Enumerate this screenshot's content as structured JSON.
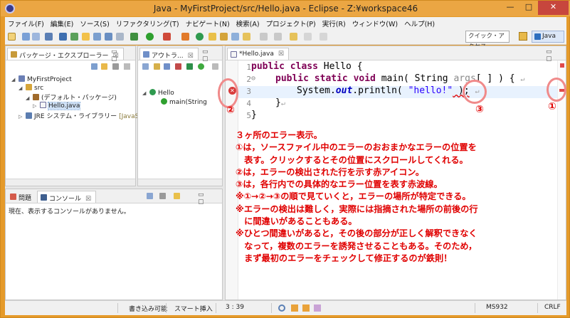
{
  "window": {
    "title": "Java - MyFirstProject/src/Hello.java - Eclipse - Z:¥workspace46",
    "minimize_glyph": "—",
    "maximize_glyph": "□",
    "close_glyph": "✕"
  },
  "menu": [
    "ファイル(F)",
    "編集(E)",
    "ソース(S)",
    "リファクタリング(T)",
    "ナビゲート(N)",
    "検索(A)",
    "プロジェクト(P)",
    "実行(R)",
    "ウィンドウ(W)",
    "ヘルプ(H)"
  ],
  "toolbar": {
    "quick_access": "クイック・アクセス",
    "perspective": "Java"
  },
  "package_explorer": {
    "tab": "パッケージ・エクスプローラー",
    "tab_close": "☒",
    "tree": [
      {
        "label": "MyFirstProject",
        "icon": "project-icon",
        "twisty": "◢"
      },
      {
        "label": "src",
        "icon": "source-folder-icon",
        "twisty": "◢"
      },
      {
        "label": "(デフォルト・パッケージ)",
        "icon": "package-icon",
        "twisty": "◢"
      },
      {
        "label": "Hello.java",
        "icon": "java-file-icon",
        "twisty": "▷"
      },
      {
        "label": "JRE システム・ライブラリー",
        "decoration": "[JavaSE-",
        "icon": "library-icon",
        "twisty": "▷"
      }
    ]
  },
  "outline": {
    "tab": "アウトラ...",
    "tab_close": "☒",
    "tree": [
      {
        "label": "Hello",
        "icon": "class-icon",
        "twisty": "◢"
      },
      {
        "label": "main(String",
        "icon": "method-icon",
        "twisty": ""
      }
    ]
  },
  "editor": {
    "tab": "*Hello.java",
    "tab_close": "☒",
    "line_numbers": [
      "1",
      "2",
      "3",
      "4",
      "5"
    ],
    "fold_markers": [
      "⊖"
    ],
    "lines": {
      "l1_kw": "public class",
      "l1_rest": " Hello {",
      "l2_kw": "public static void",
      "l2_name": " main( String ",
      "l2_param": "args",
      "l2_rest": "[ ] ) {",
      "l3_pre": "System.",
      "l3_field": "out",
      "l3_mid": ".println( ",
      "l3_str": "\"hello!\"",
      "l3_rest": " );",
      "l4": "}",
      "l5": "}",
      "eol": "↵"
    },
    "error_marker_glyph": "✕"
  },
  "annotation": {
    "labels": [
      "①",
      "②",
      "③"
    ],
    "lines": [
      "３ヶ所のエラー表示。",
      "①は，ソースファイル中のエラーのおおまかなエラーの位置を",
      "　表す。クリックするとその位置にスクロールしてくれる。",
      "②は，エラーの検出された行を示す赤アイコン。",
      "③は，各行内での具体的なエラー位置を表す赤波線。",
      "",
      "※①→②→③の順で見ていくと，エラーの場所が特定できる。",
      "※エラーの検出は難しく，実際には指摘された場所の前後の行",
      "　に間違いがあることもある。",
      "※ひとつ間違いがあると，その後の部分が正しく解釈できなく",
      "　なって，複数のエラーを誘発させることもある。そのため，",
      "　まず最初のエラーをチェックして修正するのが鉄則！"
    ]
  },
  "console": {
    "tab_problems": "問題",
    "tab_console": "コンソール",
    "tab_close": "☒",
    "message": "現在、表示するコンソールがありません。"
  },
  "statusbar": {
    "writable": "書き込み可能",
    "insert_mode": "スマート挿入",
    "position": "3 : 39",
    "encoding": "MS932",
    "line_delimiter": "CRLF"
  },
  "colors": {
    "title_bg": "#eba643",
    "error_red": "#e00000",
    "keyword": "#7f0055",
    "string": "#2a00ff",
    "field": "#0000c0"
  }
}
